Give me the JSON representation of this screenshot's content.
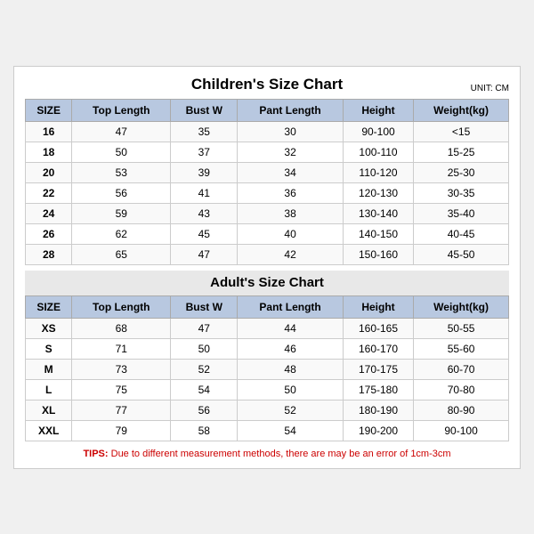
{
  "header": {
    "title": "Children's Size Chart",
    "unit": "UNIT: CM"
  },
  "children_section": {
    "title": "Children's Size Chart",
    "columns": [
      "SIZE",
      "Top Length",
      "Bust W",
      "Pant Length",
      "Height",
      "Weight(kg)"
    ],
    "rows": [
      [
        "16",
        "47",
        "35",
        "30",
        "90-100",
        "<15"
      ],
      [
        "18",
        "50",
        "37",
        "32",
        "100-110",
        "15-25"
      ],
      [
        "20",
        "53",
        "39",
        "34",
        "110-120",
        "25-30"
      ],
      [
        "22",
        "56",
        "41",
        "36",
        "120-130",
        "30-35"
      ],
      [
        "24",
        "59",
        "43",
        "38",
        "130-140",
        "35-40"
      ],
      [
        "26",
        "62",
        "45",
        "40",
        "140-150",
        "40-45"
      ],
      [
        "28",
        "65",
        "47",
        "42",
        "150-160",
        "45-50"
      ]
    ]
  },
  "adults_section": {
    "title": "Adult's Size Chart",
    "columns": [
      "SIZE",
      "Top Length",
      "Bust W",
      "Pant Length",
      "Height",
      "Weight(kg)"
    ],
    "rows": [
      [
        "XS",
        "68",
        "47",
        "44",
        "160-165",
        "50-55"
      ],
      [
        "S",
        "71",
        "50",
        "46",
        "160-170",
        "55-60"
      ],
      [
        "M",
        "73",
        "52",
        "48",
        "170-175",
        "60-70"
      ],
      [
        "L",
        "75",
        "54",
        "50",
        "175-180",
        "70-80"
      ],
      [
        "XL",
        "77",
        "56",
        "52",
        "180-190",
        "80-90"
      ],
      [
        "XXL",
        "79",
        "58",
        "54",
        "190-200",
        "90-100"
      ]
    ]
  },
  "tips": {
    "label": "TIPS:",
    "text": " Due to different measurement methods, there are may be an error of 1cm-3cm"
  }
}
